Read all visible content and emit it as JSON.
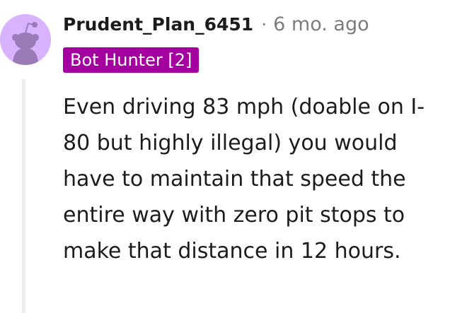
{
  "comment": {
    "author": "Prudent_Plan_6451",
    "separator": "·",
    "timestamp": "6 mo. ago",
    "flair": "Bot Hunter [2]",
    "body": "Even driving 83 mph (doable on I-80 but highly illegal) you would have to maintain that speed the entire way with zero pit stops to make that distance in 12 hours."
  },
  "icons": {
    "avatar": "snoo-avatar-icon"
  },
  "colors": {
    "avatar_bg": "#d9b3ff",
    "flair_bg": "#a400a0",
    "flair_text": "#ffffff",
    "meta_text": "#7c7c7c",
    "thread_line": "#ededed"
  }
}
